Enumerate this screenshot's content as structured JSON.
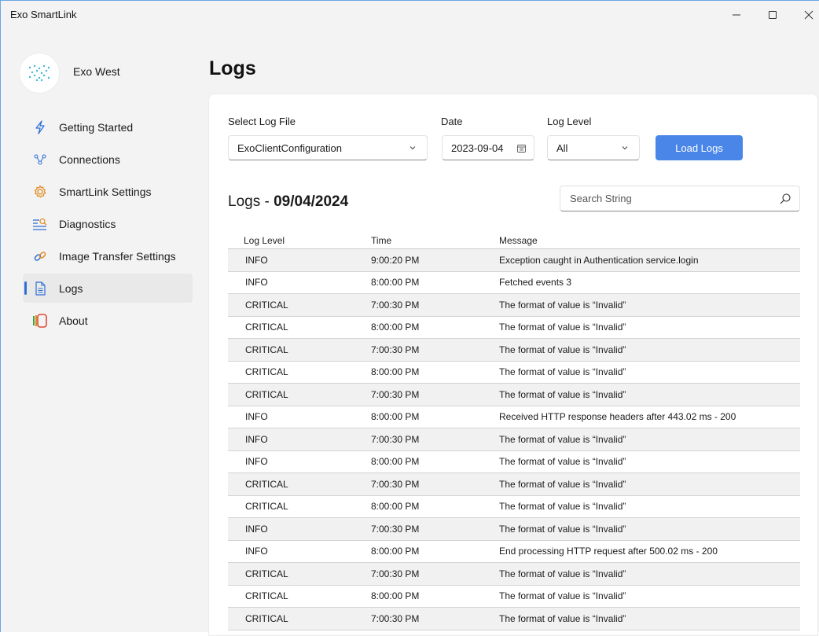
{
  "window": {
    "title": "Exo SmartLink",
    "controls": {
      "minimize": "—",
      "close": "✕"
    }
  },
  "profile": {
    "name": "Exo West"
  },
  "sidebar": {
    "items": [
      {
        "label": "Getting Started",
        "icon": "lightning-icon",
        "color": "#2f6fd6"
      },
      {
        "label": "Connections",
        "icon": "network-icon",
        "color": "#2f6fd6"
      },
      {
        "label": "SmartLink Settings",
        "icon": "gear-icon",
        "color": "#e08a1e"
      },
      {
        "label": "Diagnostics",
        "icon": "diagnostics-icon",
        "color": "#2f6fd6"
      },
      {
        "label": "Image Transfer Settings",
        "icon": "link-icon",
        "color": "#2f6fd6"
      },
      {
        "label": "Logs",
        "icon": "document-icon",
        "color": "#2f6fd6",
        "active": true
      },
      {
        "label": "About",
        "icon": "about-icon",
        "color": "#e04a3a"
      }
    ]
  },
  "main": {
    "title": "Logs",
    "filters": {
      "log_file_label": "Select Log File",
      "log_file_value": "ExoClientConfiguration",
      "date_label": "Date",
      "date_value": "2023-09-04",
      "level_label": "Log Level",
      "level_value": "All",
      "load_button": "Load Logs"
    },
    "logs_heading_prefix": "Logs - ",
    "logs_heading_date": "09/04/2024",
    "search": {
      "placeholder": "Search String"
    },
    "table": {
      "headers": {
        "level": "Log Level",
        "time": "Time",
        "message": "Message"
      },
      "rows": [
        {
          "level": "INFO",
          "time": "9:00:20 PM",
          "message": "Exception caught in Authentication service.login"
        },
        {
          "level": "INFO",
          "time": "8:00:00 PM",
          "message": "Fetched events 3"
        },
        {
          "level": "CRITICAL",
          "time": "7:00:30 PM",
          "message": "The format of value is “Invalid”"
        },
        {
          "level": "CRITICAL",
          "time": "8:00:00 PM",
          "message": "The format of value is “Invalid”"
        },
        {
          "level": "CRITICAL",
          "time": "7:00:30 PM",
          "message": "The format of value is “Invalid”"
        },
        {
          "level": "CRITICAL",
          "time": "8:00:00 PM",
          "message": "The format of value is “Invalid”"
        },
        {
          "level": "CRITICAL",
          "time": "7:00:30 PM",
          "message": "The format of value is “Invalid”"
        },
        {
          "level": "INFO",
          "time": "8:00:00 PM",
          "message": "Received HTTP response headers after 443.02 ms - 200"
        },
        {
          "level": "INFO",
          "time": "7:00:30 PM",
          "message": "The format of value is “Invalid”"
        },
        {
          "level": "INFO",
          "time": "8:00:00 PM",
          "message": "The format of value is “Invalid”"
        },
        {
          "level": "CRITICAL",
          "time": "7:00:30 PM",
          "message": "The format of value is “Invalid”"
        },
        {
          "level": "CRITICAL",
          "time": "8:00:00 PM",
          "message": "The format of value is “Invalid”"
        },
        {
          "level": "INFO",
          "time": "7:00:30 PM",
          "message": "The format of value is “Invalid”"
        },
        {
          "level": "INFO",
          "time": "8:00:00 PM",
          "message": "End processing HTTP request after 500.02 ms - 200"
        },
        {
          "level": "CRITICAL",
          "time": "7:00:30 PM",
          "message": "The format of value is “Invalid”"
        },
        {
          "level": "CRITICAL",
          "time": "8:00:00 PM",
          "message": "The format of value is “Invalid”"
        },
        {
          "level": "CRITICAL",
          "time": "7:00:30 PM",
          "message": "The format of value is “Invalid”"
        }
      ]
    }
  }
}
